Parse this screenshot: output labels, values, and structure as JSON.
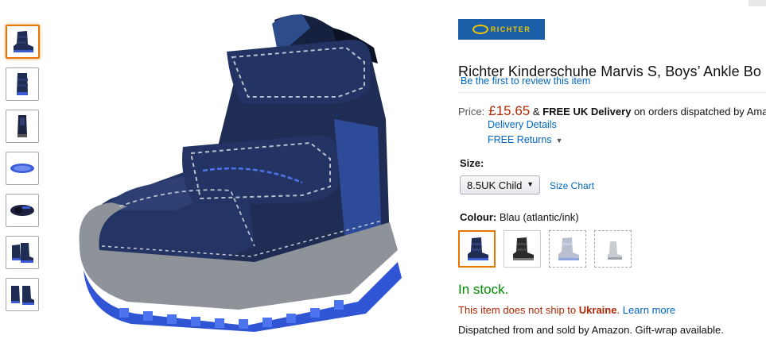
{
  "brand": {
    "logo_text": "RICHTER"
  },
  "product": {
    "title": "Richter Kinderschuhe Marvis S, Boys’ Ankle Bo",
    "review_link": "Be the first to review this item"
  },
  "price": {
    "label": "Price:",
    "amount": "£15.65",
    "amp": "&",
    "free_delivery": "FREE UK Delivery",
    "delivery_suffix": "on orders dispatched by Ama",
    "delivery_details": "Delivery Details",
    "free_returns": "FREE Returns",
    "returns_caret": "▼"
  },
  "size": {
    "label": "Size:",
    "selected": "8.5UK Child",
    "chart_link": "Size Chart"
  },
  "colour": {
    "label": "Colour:",
    "value": "Blau (atlantic/ink)",
    "swatches": [
      {
        "name": "navy",
        "color": "#1f2d55",
        "state": "selected"
      },
      {
        "name": "black-grey",
        "color": "#2b2b2b",
        "state": "available"
      },
      {
        "name": "light-grey-blue",
        "color": "#b7bfd0",
        "state": "unavailable"
      },
      {
        "name": "light-grey",
        "color": "#c8cbd0",
        "state": "unavailable"
      }
    ]
  },
  "stock": {
    "text": "In stock."
  },
  "shipping": {
    "prefix": "This item does not ship to",
    "country": "Ukraine",
    "period": ".",
    "learn_more": "Learn more"
  },
  "dispatch": {
    "text": "Dispatched from and sold by Amazon. Gift-wrap available."
  },
  "thumbnails": [
    {
      "name": "boot-side"
    },
    {
      "name": "boot-front"
    },
    {
      "name": "boot-back"
    },
    {
      "name": "boot-sole"
    },
    {
      "name": "boot-top"
    },
    {
      "name": "boot-pair"
    },
    {
      "name": "boot-pair-2"
    }
  ],
  "colors": {
    "link": "#0066c0",
    "price": "#b12704",
    "stock": "#008a00",
    "brand_bg": "#1a5fa8",
    "brand_fg": "#f2c500",
    "highlight": "#e77600"
  }
}
